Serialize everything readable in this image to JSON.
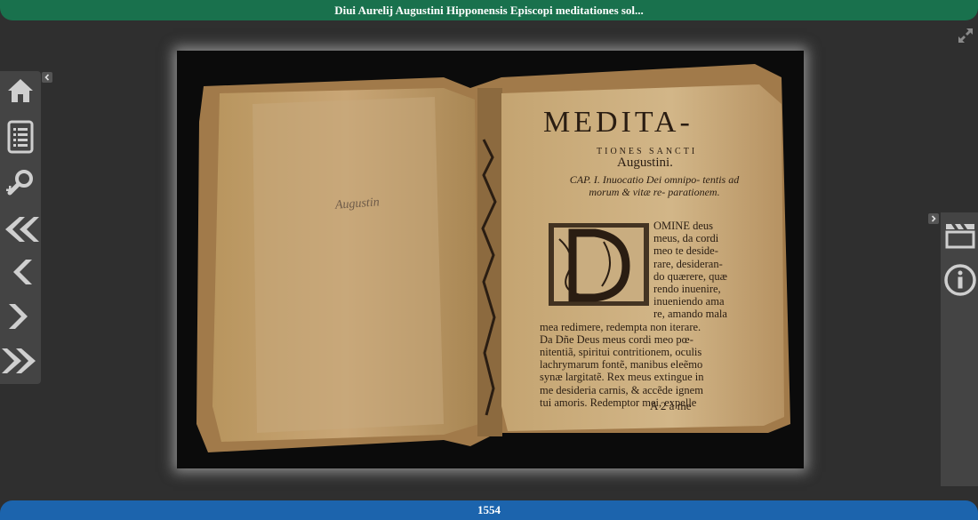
{
  "header": {
    "title": "Diui Aurelij Augustini Hipponensis Episcopi meditationes sol..."
  },
  "footer": {
    "label": "1554"
  },
  "left_toolbar": {
    "buttons": [
      {
        "icon": "home-icon"
      },
      {
        "icon": "table-of-contents-icon"
      },
      {
        "icon": "zoom-icon"
      },
      {
        "icon": "first-page-icon"
      },
      {
        "icon": "previous-page-icon"
      },
      {
        "icon": "next-page-icon"
      },
      {
        "icon": "last-page-icon"
      }
    ]
  },
  "right_toolbar": {
    "buttons": [
      {
        "icon": "clapperboard-icon"
      },
      {
        "icon": "info-icon"
      }
    ]
  },
  "page_image": {
    "title_line1": "MEDITA-",
    "title_line2": "TIONES SANCTI",
    "title_line3": "Augustini.",
    "chapter": "CAP. I. Inuocatio Dei omnipo- tentis ad morum & vitæ re- parationem.",
    "body_lines": [
      "OMINE deus",
      "meus, da cordi",
      "meo te deside-",
      "rare, desideran-",
      "do quærere, quæ",
      "rendo inuenire,",
      "inueniendo ama",
      "re, amando mala",
      "mea redimere, redempta non iterare.",
      "Da Dñe Deus meus cordi meo pœ-",
      "nitentiã, spiritui contritionem, oculis",
      "lachrymarum fontẽ, manibus eleẽmo",
      "synæ largitatẽ. Rex meus extingue in",
      "me desideria carnis, & accẽde ignem",
      "tui amoris. Redemptor mei, expelle"
    ],
    "signature": "A 2    à me",
    "handwriting": "Augustin"
  },
  "colors": {
    "header_bg": "#19714d",
    "footer_bg": "#1c64ad",
    "background": "#2f2f2f",
    "toolbar_bg": "#444444",
    "icon": "#cfcfcf"
  }
}
